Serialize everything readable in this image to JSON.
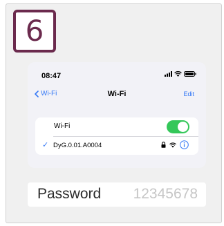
{
  "step": {
    "number": "6",
    "color": "#6b2a4d"
  },
  "phone": {
    "status_bar": {
      "time": "08:47",
      "icons": [
        "cellular-signal-icon",
        "wifi-icon",
        "battery-icon"
      ]
    },
    "nav": {
      "back_label": "Wi-Fi",
      "title": "Wi-Fi",
      "edit_label": "Edit"
    },
    "wifi_toggle": {
      "label": "Wi-Fi",
      "on": true,
      "color": "#34c759"
    },
    "network": {
      "name": "DyG.0.01.A0004",
      "connected": true,
      "icons": [
        "lock-icon",
        "wifi-icon",
        "info-icon"
      ]
    },
    "accent_color": "#3478f6"
  },
  "password_field": {
    "label": "Password",
    "value": "12345678"
  }
}
